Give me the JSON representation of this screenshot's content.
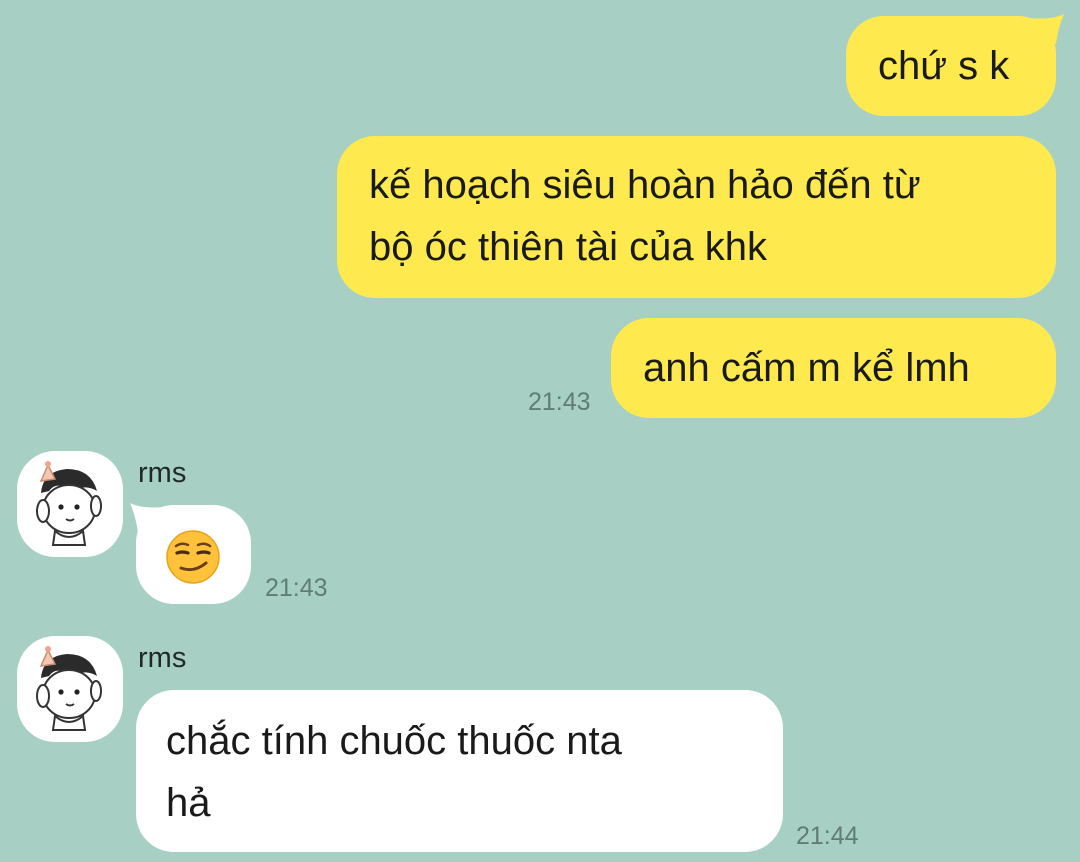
{
  "conversation": {
    "background_color": "#a7cfc3",
    "outgoing_bubble_color": "#fee94e",
    "incoming_bubble_color": "#ffffff",
    "messages": [
      {
        "direction": "outgoing",
        "text": "chứ s k"
      },
      {
        "direction": "outgoing",
        "text_lines": [
          "kế hoạch siêu hoàn hảo đến từ",
          "bộ óc thiên tài của khk"
        ]
      },
      {
        "direction": "outgoing",
        "text": "anh cấm m kể lmh",
        "time": "21:43"
      },
      {
        "direction": "incoming",
        "sender": "rms",
        "emoji": "smirking-face",
        "time": "21:43"
      },
      {
        "direction": "incoming",
        "sender": "rms",
        "text_lines": [
          "chắc tính chuốc thuốc nta",
          "hả"
        ],
        "time": "21:44"
      }
    ]
  },
  "icons": {
    "avatar": "cartoon-boy-party-hat-avatar-icon",
    "emoji": "smirking-face-emoji-icon"
  }
}
